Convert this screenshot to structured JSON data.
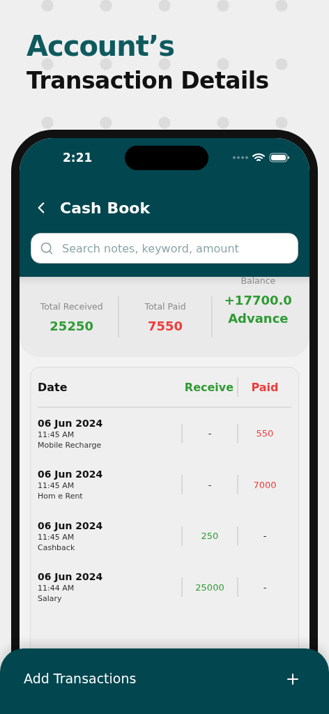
{
  "headline": {
    "line_1": "Account’s",
    "line_2": "Transaction Details"
  },
  "status_bar": {
    "time": "2:21"
  },
  "header": {
    "title": "Cash Book"
  },
  "search": {
    "placeholder": "Search notes, keyword, amount"
  },
  "summary": [
    {
      "label": "Total Received",
      "value": "25250",
      "color": "#2e9b33"
    },
    {
      "label": "Total Paid",
      "value": "7550",
      "color": "#ef3b3b"
    }
  ],
  "balance": {
    "label": "Balance",
    "value": "+17700.0",
    "note": "Advance"
  },
  "table": {
    "columns": [
      {
        "label": "Date",
        "color": "#111111"
      },
      {
        "label": "Receive",
        "color": "#2e9b33"
      },
      {
        "label": "Paid",
        "color": "#ef3b3b"
      }
    ],
    "rows": [
      {
        "date": "06 Jun 2024",
        "time": "11:45 AM",
        "note": "Mobile Recharge",
        "receive": "-",
        "paid": "550"
      },
      {
        "date": "06 Jun 2024",
        "time": "11:45 AM",
        "note": "Hom e Rent",
        "receive": "-",
        "paid": "7000"
      },
      {
        "date": "06 Jun 2024",
        "time": "11:45 AM",
        "note": "Cashback",
        "receive": "250",
        "paid": "-"
      },
      {
        "date": "06 Jun 2024",
        "time": "11:44 AM",
        "note": "Salary",
        "receive": "25000",
        "paid": "-"
      }
    ]
  },
  "action": {
    "label": "Add Transactions"
  }
}
